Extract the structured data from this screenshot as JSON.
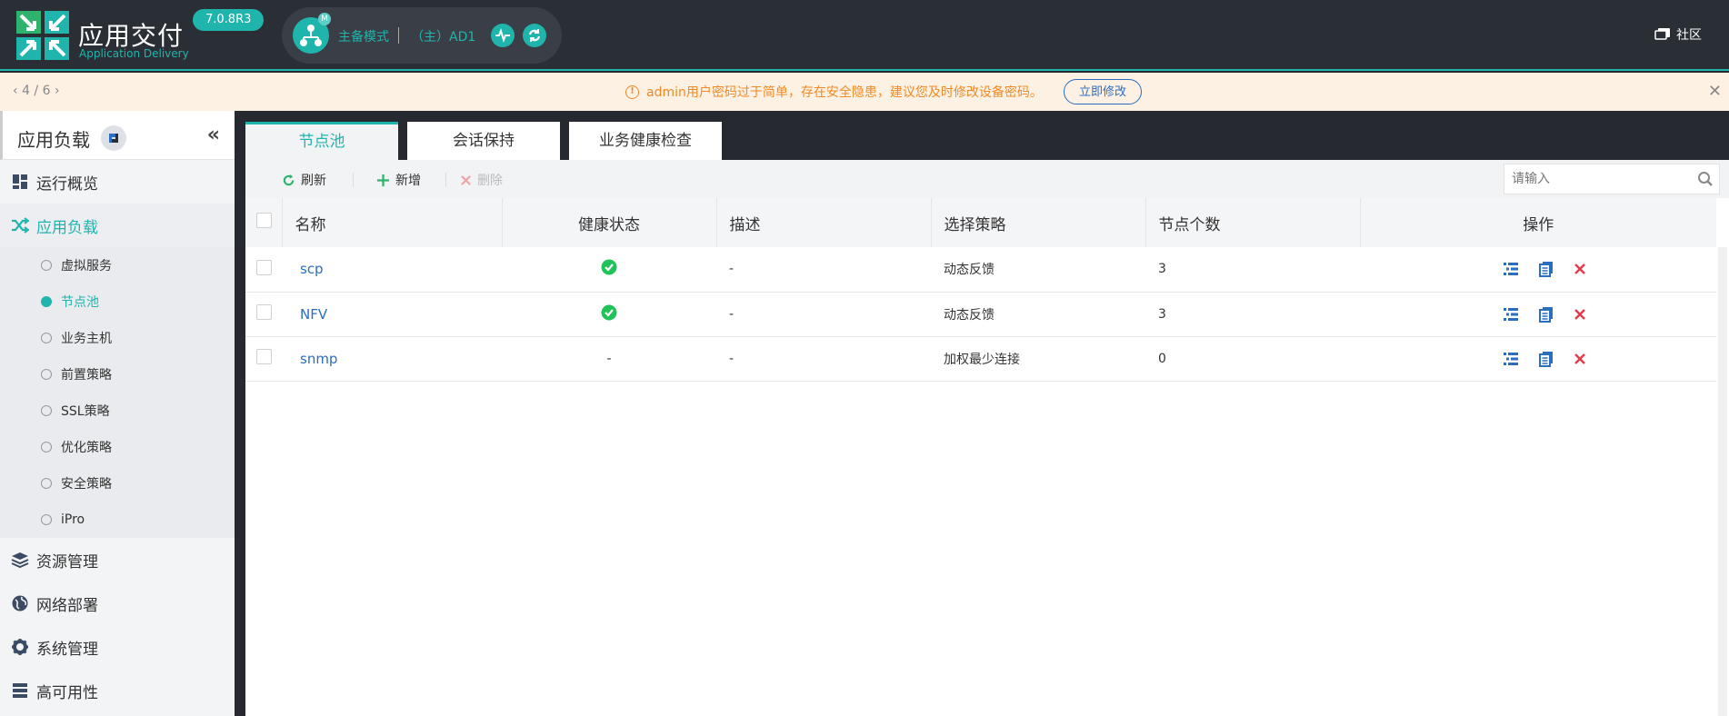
{
  "header": {
    "brand_title": "应用交付",
    "brand_subtitle": "Application Delivery",
    "version": "7.0.8R3",
    "mode_badge": "M",
    "mode_label": "主备模式",
    "device_label": "（主）AD1",
    "community_label": "社区"
  },
  "notice": {
    "pager": "4 / 6",
    "message": "admin用户密码过于简单，存在安全隐患，建议您及时修改设备密码。",
    "fix_button": "立即修改"
  },
  "sidebar": {
    "title": "应用负载",
    "menu": [
      {
        "label": "运行概览",
        "icon": "dashboard-icon"
      },
      {
        "label": "应用负载",
        "icon": "shuffle-icon"
      },
      {
        "label": "资源管理",
        "icon": "layers-icon"
      },
      {
        "label": "网络部署",
        "icon": "globe-icon"
      },
      {
        "label": "系统管理",
        "icon": "gear-icon"
      },
      {
        "label": "高可用性",
        "icon": "server-icon"
      }
    ],
    "submenu": [
      {
        "label": "虚拟服务"
      },
      {
        "label": "节点池"
      },
      {
        "label": "业务主机"
      },
      {
        "label": "前置策略"
      },
      {
        "label": "SSL策略"
      },
      {
        "label": "优化策略"
      },
      {
        "label": "安全策略"
      },
      {
        "label": "iPro"
      }
    ]
  },
  "tabs": [
    {
      "label": "节点池"
    },
    {
      "label": "会话保持"
    },
    {
      "label": "业务健康检查"
    }
  ],
  "toolbar": {
    "refresh": "刷新",
    "add": "新增",
    "delete": "删除",
    "search_placeholder": "请输入"
  },
  "table": {
    "columns": [
      "名称",
      "健康状态",
      "描述",
      "选择策略",
      "节点个数",
      "操作"
    ],
    "rows": [
      {
        "name": "scp",
        "health": "ok",
        "health_text": "",
        "desc": "-",
        "strategy": "动态反馈",
        "count": "3"
      },
      {
        "name": "NFV",
        "health": "ok",
        "health_text": "",
        "desc": "-",
        "strategy": "动态反馈",
        "count": "3"
      },
      {
        "name": "snmp",
        "health": "none",
        "health_text": "-",
        "desc": "-",
        "strategy": "加权最少连接",
        "count": "0"
      }
    ]
  },
  "colors": {
    "accent": "#1fb5ad",
    "link": "#2a6ebf",
    "warning": "#f08a24",
    "danger": "#e03c4c",
    "success": "#22c25a"
  }
}
